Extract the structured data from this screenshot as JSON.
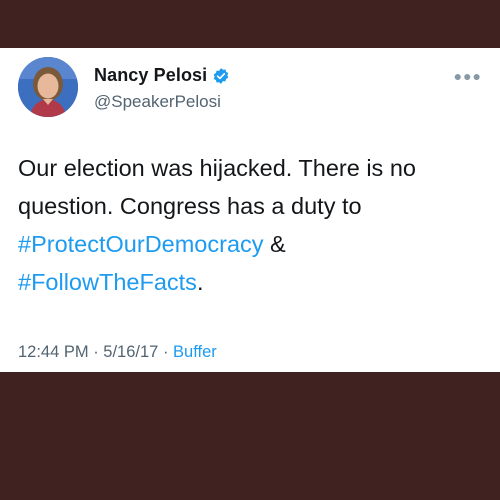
{
  "tweet": {
    "author_name": "Nancy Pelosi",
    "handle": "@SpeakerPelosi",
    "more_icon": "more-icon",
    "line1": "Our election was hijacked. There is no",
    "line2": "question. Congress has a duty to",
    "hashtag1": "#ProtectOurDemocracy",
    "amp": " &",
    "hashtag2": "#FollowTheFacts",
    "period": ".",
    "time": "12:44 PM",
    "sep1": " · ",
    "date": "5/16/17",
    "sep2": " · ",
    "source": "Buffer"
  },
  "colors": {
    "accent": "#1d9bf0",
    "frame": "#402220"
  }
}
